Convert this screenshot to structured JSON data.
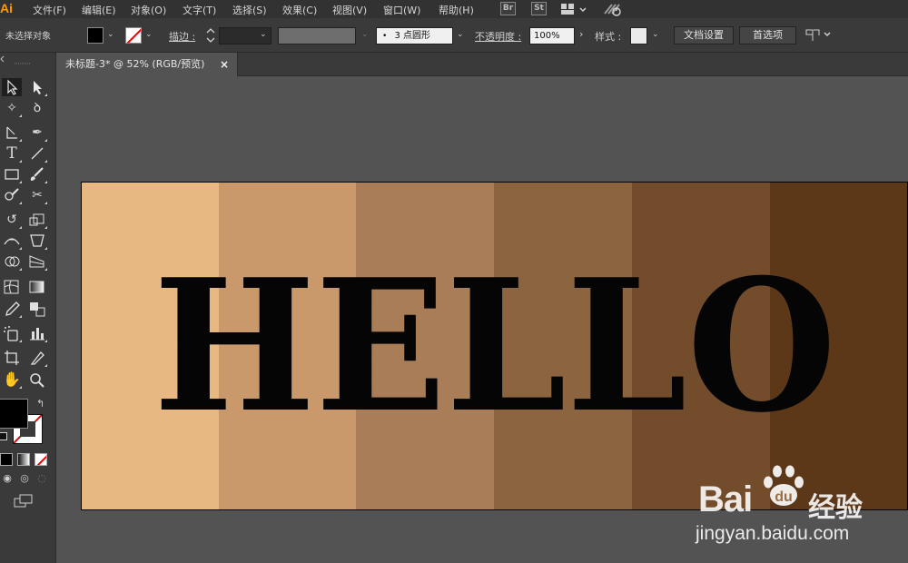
{
  "app": {
    "logo": "Ai"
  },
  "menubar": {
    "items": [
      "文件(F)",
      "编辑(E)",
      "对象(O)",
      "文字(T)",
      "选择(S)",
      "效果(C)",
      "视图(V)",
      "窗口(W)",
      "帮助(H)"
    ],
    "br": "Br",
    "st": "St"
  },
  "controlbar": {
    "selection": "未选择对象",
    "stroke_label": "描边 :",
    "brush_value": "3 点圆形",
    "opacity_label": "不透明度 :",
    "opacity_value": "100%",
    "style_label": "样式 :",
    "doc_setup_button": "文档设置",
    "prefs_button": "首选项"
  },
  "document": {
    "tab_title": "未标题-3* @ 52% (RGB/预览)",
    "close": "×"
  },
  "artwork": {
    "text": "HELLO",
    "bands": [
      "#e8b882",
      "#c9996c",
      "#a87d57",
      "#8c6440",
      "#734c2b",
      "#5c3818"
    ]
  },
  "watermark": {
    "brand": "Bai",
    "brand_cn": "经验",
    "url": "jingyan.baidu.com"
  }
}
